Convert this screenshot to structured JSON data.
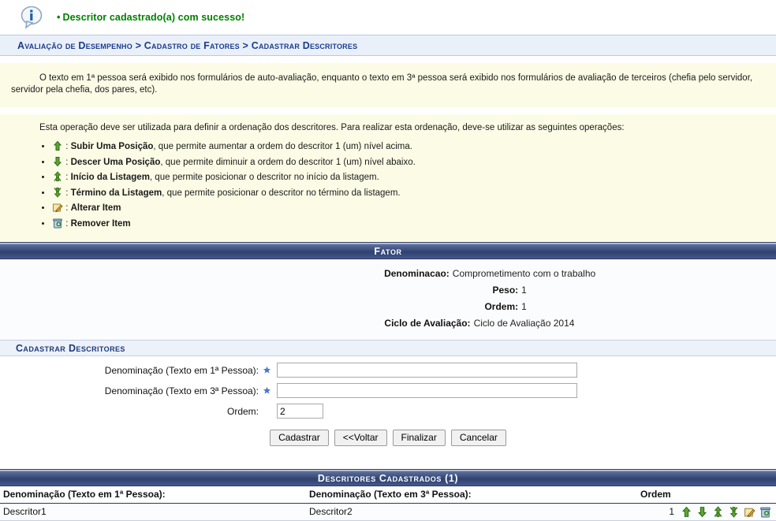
{
  "message": {
    "icon": "info-speech-bubble-icon",
    "bullet": "•",
    "text": "Descritor cadastrado(a) com sucesso!",
    "color": "#008000"
  },
  "breadcrumb": {
    "text": "Avaliação de Desempenho > Cadastro de Fatores > Cadastrar Descritores",
    "color": "#1a3c8c"
  },
  "notes": {
    "first": "O texto em 1ª pessoa será exibido nos formulários de auto-avaliação, enquanto o texto em 3ª pessoa será exibido nos formulários de avaliação de terceiros (chefia pelo servidor, servidor pela chefia, dos pares, etc).",
    "second_intro": "Esta operação deve ser utilizada para definir a ordenação dos descritores. Para realizar esta ordenação, deve-se utilizar as seguintes operações:",
    "legend": [
      {
        "icon": "arrow-up-icon",
        "name": "Subir Uma Posição",
        "desc": ", que permite aumentar a ordem do descritor 1 (um) nível acima."
      },
      {
        "icon": "arrow-down-icon",
        "name": "Descer Uma Posição",
        "desc": ", que permite diminuir a ordem do descritor 1 (um) nível abaixo."
      },
      {
        "icon": "move-to-top-icon",
        "name": "Início da Listagem",
        "desc": ", que permite posicionar o descritor no início da listagem."
      },
      {
        "icon": "move-to-bottom-icon",
        "name": "Término da Listagem",
        "desc": ", que permite posicionar o descritor no término da listagem."
      },
      {
        "icon": "edit-pencil-icon",
        "name": "Alterar Item",
        "desc": ""
      },
      {
        "icon": "trash-can-icon",
        "name": "Remover Item",
        "desc": ""
      }
    ]
  },
  "factor": {
    "title": "Fator",
    "rows": [
      {
        "label": "Denominacao:",
        "value": "Comprometimento com o trabalho"
      },
      {
        "label": "Peso:",
        "value": "1"
      },
      {
        "label": "Ordem:",
        "value": "1"
      },
      {
        "label": "Ciclo de Avaliação:",
        "value": "Ciclo de Avaliação 2014"
      }
    ]
  },
  "form": {
    "subtitle": "Cadastrar Descritores",
    "fields": [
      {
        "label": "Denominação (Texto em 1ª Pessoa):",
        "required": true,
        "value": "",
        "placeholder": ""
      },
      {
        "label": "Denominação (Texto em 3ª Pessoa):",
        "required": true,
        "value": "",
        "placeholder": ""
      }
    ],
    "order": {
      "label": "Ordem:",
      "value": "2",
      "placeholder": ""
    },
    "buttons": [
      {
        "label": "Cadastrar"
      },
      {
        "label": "<<Voltar"
      },
      {
        "label": "Finalizar"
      },
      {
        "label": "Cancelar"
      }
    ]
  },
  "listing": {
    "title": "Descritores Cadastrados (1)",
    "count": "1",
    "columns": [
      "Denominação (Texto em 1ª Pessoa):",
      "Denominação (Texto em 3ª Pessoa):",
      "Ordem"
    ],
    "rows": [
      {
        "first_person": "Descritor1",
        "third_person": "Descritor2",
        "order": "1",
        "actions": [
          "arrow-up-icon",
          "arrow-down-icon",
          "move-to-top-icon",
          "move-to-bottom-icon",
          "edit-pencil-icon",
          "trash-can-icon"
        ]
      }
    ]
  },
  "colors": {
    "header_gradient_top": "#5c6e9c",
    "header_gradient_mid": "#2f4270",
    "header_gradient_bottom": "#465a8c",
    "breadcrumb_bg": "#eaf0fa",
    "note_bg": "#fcfce6",
    "success_green": "#008000",
    "link_blue": "#1a3c8c"
  }
}
